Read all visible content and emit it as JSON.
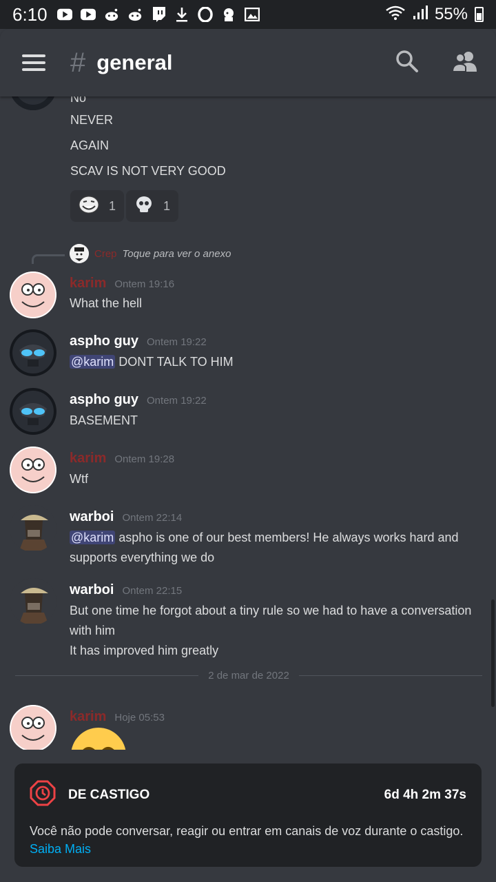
{
  "status_bar": {
    "time": "6:10",
    "battery": "55%",
    "icons": [
      "youtube-icon",
      "youtube-icon",
      "reddit-icon",
      "reddit-icon",
      "twitch-icon",
      "download-icon",
      "opera-icon",
      "game-icon",
      "image-icon"
    ]
  },
  "header": {
    "hash": "#",
    "channel": "general"
  },
  "messages": {
    "partial_top": "No",
    "cont_lines": [
      "NEVER",
      "AGAIN",
      "SCAV IS NOT VERY GOOD"
    ],
    "reactions": [
      {
        "icon": "trollface-icon",
        "count": "1"
      },
      {
        "icon": "skull-icon",
        "count": "1"
      }
    ],
    "reply": {
      "author": "Crep",
      "text": "Toque para ver o anexo"
    },
    "m1": {
      "author": "karim",
      "time": "Ontem 19:16",
      "text": "What the hell"
    },
    "m2": {
      "author": "aspho guy",
      "time": "Ontem 19:22",
      "mention": "@karim",
      "text": " DONT TALK TO HIM"
    },
    "m3": {
      "author": "aspho guy",
      "time": "Ontem 19:22",
      "text": "BASEMENT"
    },
    "m4": {
      "author": "karim",
      "time": "Ontem 19:28",
      "text": "Wtf"
    },
    "m5": {
      "author": "warboi",
      "time": "Ontem 22:14",
      "mention": "@karim",
      "text": " aspho is one of our best members! He always works hard and supports everything we do"
    },
    "m6": {
      "author": "warboi",
      "time": "Ontem 22:15",
      "line1": "But one time he forgot about a tiny rule so we had to have a conversation with him",
      "line2": "It has improved him greatly"
    },
    "date_divider": "2 de mar de 2022",
    "m7": {
      "author": "karim",
      "time": "Hoje 05:53"
    }
  },
  "timeout": {
    "title": "DE CASTIGO",
    "timer": "6d 4h 2m 37s",
    "body": "Você não pode conversar, reagir ou entrar em canais de voz durante o castigo. ",
    "link": "Saiba Mais"
  },
  "colors": {
    "background": "#36393f",
    "panel": "#202225",
    "danger": "#ed4245",
    "link": "#00aff4",
    "muted_red_name": "#8b2a2a"
  }
}
